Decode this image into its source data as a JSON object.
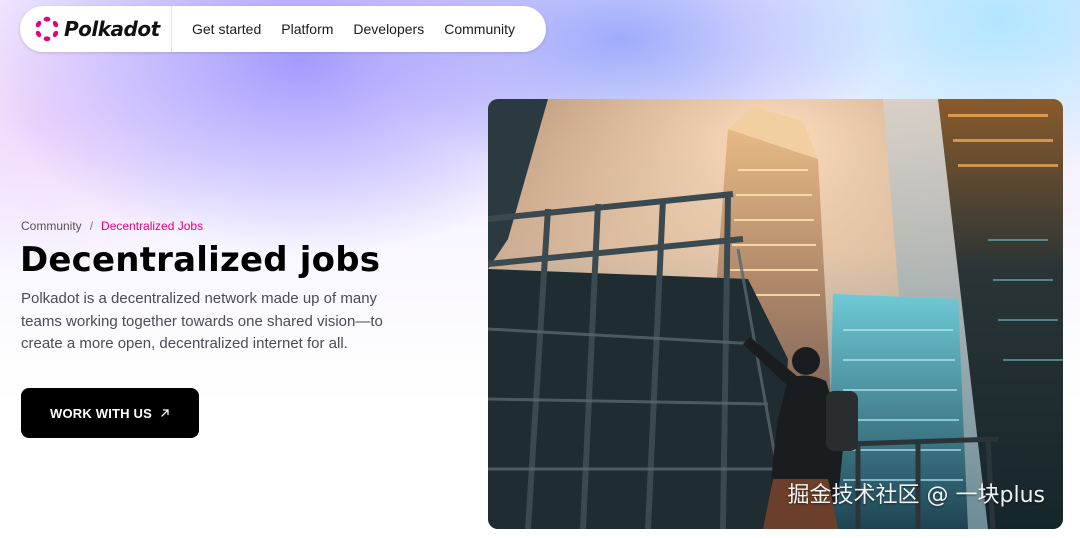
{
  "brand": {
    "name": "Polkadot",
    "accent_color": "#e6007a",
    "logo_icon": "polkadot-logo-icon"
  },
  "nav": {
    "items": [
      {
        "label": "Get started"
      },
      {
        "label": "Platform"
      },
      {
        "label": "Developers"
      },
      {
        "label": "Community"
      }
    ]
  },
  "breadcrumb": {
    "parent": "Community",
    "separator": "/",
    "current": "Decentralized Jobs"
  },
  "hero": {
    "title": "Decentralized jobs",
    "description": "Polkadot is a decentralized network made up of many teams working together towards one shared vision—to create a more open, decentralized internet for all.",
    "cta_label": "WORK WITH US",
    "cta_icon": "arrow-up-right-icon",
    "image": "city-night-climber-photo"
  },
  "watermark": "掘金技术社区 @ 一块plus"
}
